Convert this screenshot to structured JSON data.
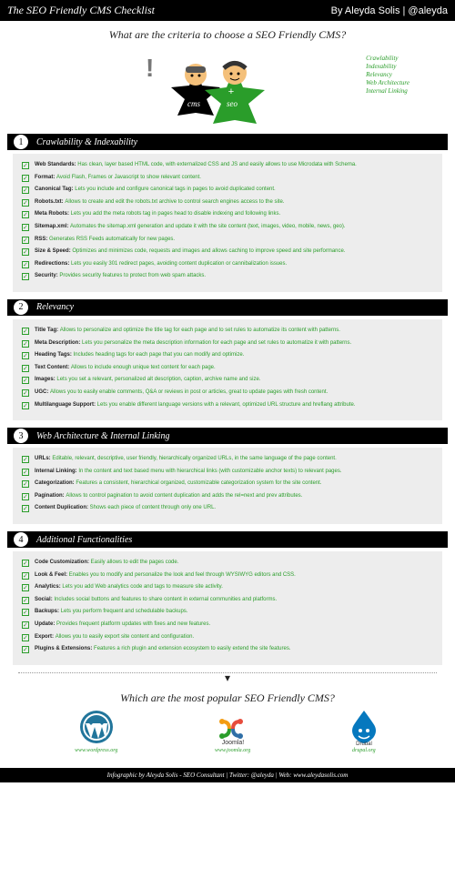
{
  "header": {
    "title": "The SEO Friendly CMS Checklist",
    "by": "By Aleyda Solis | @aleyda"
  },
  "subtitle": "What are the criteria to choose a SEO Friendly CMS?",
  "criteria": [
    "Crawlability",
    "Indexability",
    "Relevancy",
    "Web Architecture",
    "Internal Linking"
  ],
  "sections": [
    {
      "num": "1",
      "title": "Crawlability & Indexability",
      "items": [
        {
          "label": "Web Standards",
          "desc": "Has clean, layer based HTML code, with externalized CSS and JS and easily allows to use Microdata with Schema."
        },
        {
          "label": "Format",
          "desc": "Avoid Flash, Frames or Javascript to show relevant content."
        },
        {
          "label": "Canonical Tag",
          "desc": "Lets you include and configure canonical tags in pages to avoid duplicated content."
        },
        {
          "label": "Robots.txt",
          "desc": "Allows to create and edit the robots.txt archive to control search engines access to the site."
        },
        {
          "label": "Meta Robots",
          "desc": "Lets you add the meta robots tag in pages head to disable indexing and following links."
        },
        {
          "label": "Sitemap.xml",
          "desc": "Automates the sitemap.xml generation and update it with the site content (text, images, video, mobile, news, geo)."
        },
        {
          "label": "RSS",
          "desc": "Generates RSS Feeds automatically for new pages."
        },
        {
          "label": "Size & Speed",
          "desc": "Optimizes and minimizes code, requests and images and allows caching  to improve speed and site performance."
        },
        {
          "label": "Redirections",
          "desc": "Lets you easily 301 redirect pages, avoiding content duplication or cannibalization issues."
        },
        {
          "label": "Security",
          "desc": "Provides security features to protect from web spam attacks."
        }
      ]
    },
    {
      "num": "2",
      "title": "Relevancy",
      "items": [
        {
          "label": "Title Tag",
          "desc": "Allows to personalize and optimize the title tag for each page and to set rules to automatize its content with patterns."
        },
        {
          "label": "Meta Description",
          "desc": "Lets you personalize the meta description information for each page and set rules to automatize it with patterns."
        },
        {
          "label": "Heading Tags",
          "desc": "Includes heading tags for each page that you can modify and optimize."
        },
        {
          "label": "Text Content",
          "desc": "Allows to include enough unique text content for each page."
        },
        {
          "label": "Images",
          "desc": "Lets you set a relevant, personalized alt description, caption, archive name and size."
        },
        {
          "label": "UGC",
          "desc": "Allows you to easily enable comments, Q&A or reviews in post or articles, great to update pages with fresh content."
        },
        {
          "label": "Multilanguage Support",
          "desc": "Lets you enable different language versions with a relevant, optimized URL structure and hreflang attribute."
        }
      ]
    },
    {
      "num": "3",
      "title": "Web Architecture & Internal Linking",
      "items": [
        {
          "label": "URLs",
          "desc": "Editable, relevant, descriptive, user friendly, hierarchically organized URLs, in the same language of the page content."
        },
        {
          "label": "Internal Linking",
          "desc": "In the content and text based menu with hierarchical links (with customizable anchor texts) to relevant pages."
        },
        {
          "label": "Categorization",
          "desc": "Features a consistent, hierarchical organized, customizable categorization system for the site content."
        },
        {
          "label": "Pagination",
          "desc": "Allows to control pagination to avoid content duplication and adds the rel=next and prev attributes."
        },
        {
          "label": "Content Duplication",
          "desc": "Shows each piece of content through only one URL."
        }
      ]
    },
    {
      "num": "4",
      "title": "Additional Functionalities",
      "items": [
        {
          "label": "Code Customization",
          "desc": "Easily allows to edit the pages code."
        },
        {
          "label": "Look & Feel",
          "desc": "Enables you to modify and personalize the look and feel through WYSIWYG editors and CSS."
        },
        {
          "label": "Analytics",
          "desc": "Lets you add Web analytics code and tags to measure site activity."
        },
        {
          "label": "Social",
          "desc": "Includes social buttons and features to share content in external communities and platforms."
        },
        {
          "label": "Backups",
          "desc": "Lets you perform frequent and schedulable backups."
        },
        {
          "label": "Update",
          "desc": "Provides frequent platform updates with fixes and new features."
        },
        {
          "label": "Export",
          "desc": "Allows you to easily export site content and configuration."
        },
        {
          "label": "Plugins & Extensions",
          "desc": "Features a rich plugin and extension ecosystem to easily extend the site features."
        }
      ]
    }
  ],
  "popular": {
    "question": "Which are the most popular SEO Friendly CMS?",
    "cms": [
      {
        "name": "WordPress",
        "url": "www.wordpress.org"
      },
      {
        "name": "Joomla!",
        "url": "www.joomla.org"
      },
      {
        "name": "Drupal",
        "url": "drupal.org"
      }
    ]
  },
  "footer": "Infographic by Aleyda Solis - SEO Consultant  |  Twitter: @aleyda  |  Web: www.aleydasolis.com"
}
